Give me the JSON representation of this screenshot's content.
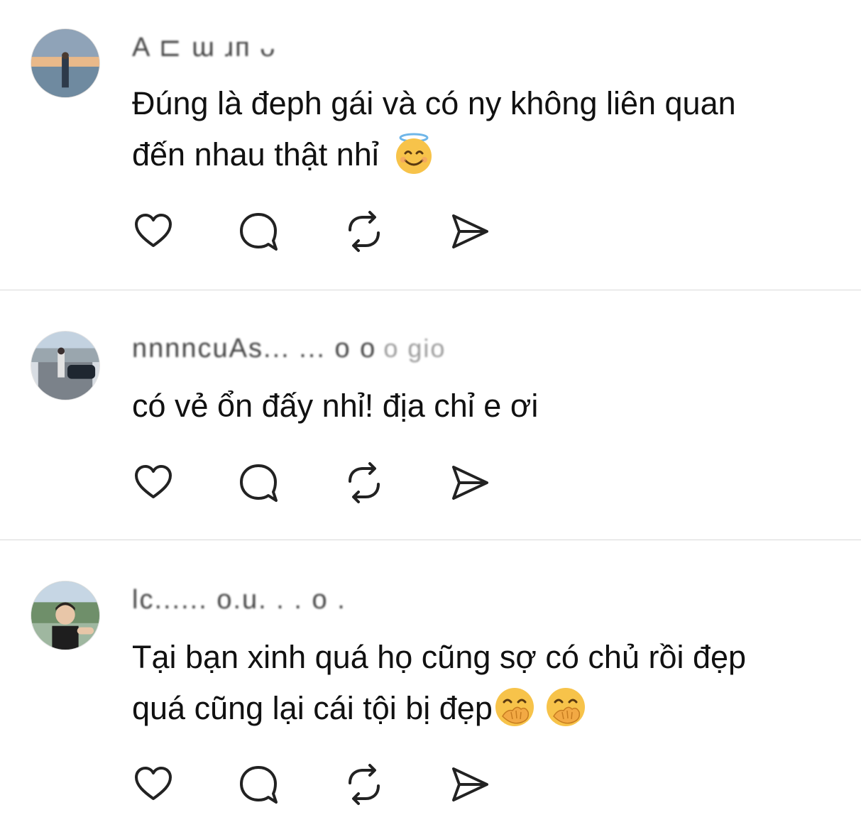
{
  "replies": [
    {
      "username": "A ⊏ ɯ ɹᴨ ᴗ",
      "time": "",
      "text": "Đúng là đeph gái và có ny không liên quan\nđến nhau thật nhỉ ",
      "emojis": [
        "smiling-face-with-halo"
      ],
      "actions": [
        "like",
        "comment",
        "repost",
        "share"
      ]
    },
    {
      "username": "nnnncuAs... ... o o",
      "time": "o gio",
      "text": "có vẻ ổn đấy nhỉ! địa chỉ e ơi",
      "emojis": [],
      "actions": [
        "like",
        "comment",
        "repost",
        "share"
      ]
    },
    {
      "username": "lc...... o.u. . . o .",
      "time": "",
      "text": "Tại bạn xinh quá họ cũng sợ có chủ rồi đẹp\nquá cũng lại cái tội bị đẹp",
      "emojis": [
        "face-with-hand-over-mouth",
        "face-with-hand-over-mouth"
      ],
      "actions": [
        "like",
        "comment",
        "repost",
        "share"
      ]
    }
  ],
  "icons": {
    "like": "heart-icon",
    "comment": "speech-bubble-icon",
    "repost": "repost-icon",
    "share": "paper-plane-icon"
  },
  "colors": {
    "text": "#111111",
    "icon": "#222222",
    "divider": "#d9d9d9",
    "emoji_yellow": "#f7c34a"
  }
}
